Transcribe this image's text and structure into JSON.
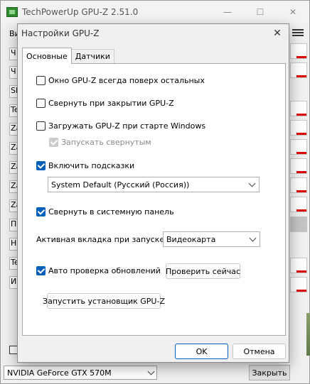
{
  "main_window": {
    "title": "TechPowerUp GPU-Z 2.51.0",
    "tab_partial": "Ви",
    "field_stubs": [
      "Ч",
      "Ч",
      "SI",
      "Te",
      "Za",
      "Za",
      "Za",
      "Za",
      "Za",
      "Пр",
      "Н",
      "Te",
      "Из"
    ],
    "gpu_select_value": "NVIDIA GeForce GTX 570M",
    "close_button_label": "Закрыть",
    "window_buttons": {
      "minimize": "—",
      "maximize": "☐",
      "close": "✕"
    }
  },
  "dialog": {
    "title": "Настройки GPU-Z",
    "close_glyph": "✕",
    "tabs": [
      {
        "label": "Основные",
        "active": true
      },
      {
        "label": "Датчики",
        "active": false
      }
    ],
    "options": {
      "always_on_top": {
        "label": "Окно GPU-Z всегда поверх остальных",
        "checked": false
      },
      "minimize_on_close": {
        "label": "Свернуть при закрытии GPU-Z",
        "checked": false
      },
      "start_with_windows": {
        "label": "Загружать GPU-Z при старте Windows",
        "checked": false
      },
      "start_minimized": {
        "label": "Запускать свернутым",
        "checked": true,
        "disabled": true
      },
      "enable_tooltips": {
        "label": "Включить подсказки",
        "checked": true
      },
      "minimize_to_tray": {
        "label": "Свернуть в системную панель",
        "checked": true
      },
      "auto_update_check": {
        "label": "Авто проверка обновлений",
        "checked": true
      }
    },
    "language_select": {
      "value": "System Default (Русский (Россия))"
    },
    "startup_tab": {
      "label": "Активная вкладка при запуске:",
      "value": "Видеокарта"
    },
    "check_now_button": "Проверить сейчас",
    "run_installer_button": "Запустить установщик GPU-Z",
    "ok_button": "OK",
    "cancel_button": "Отмена"
  }
}
